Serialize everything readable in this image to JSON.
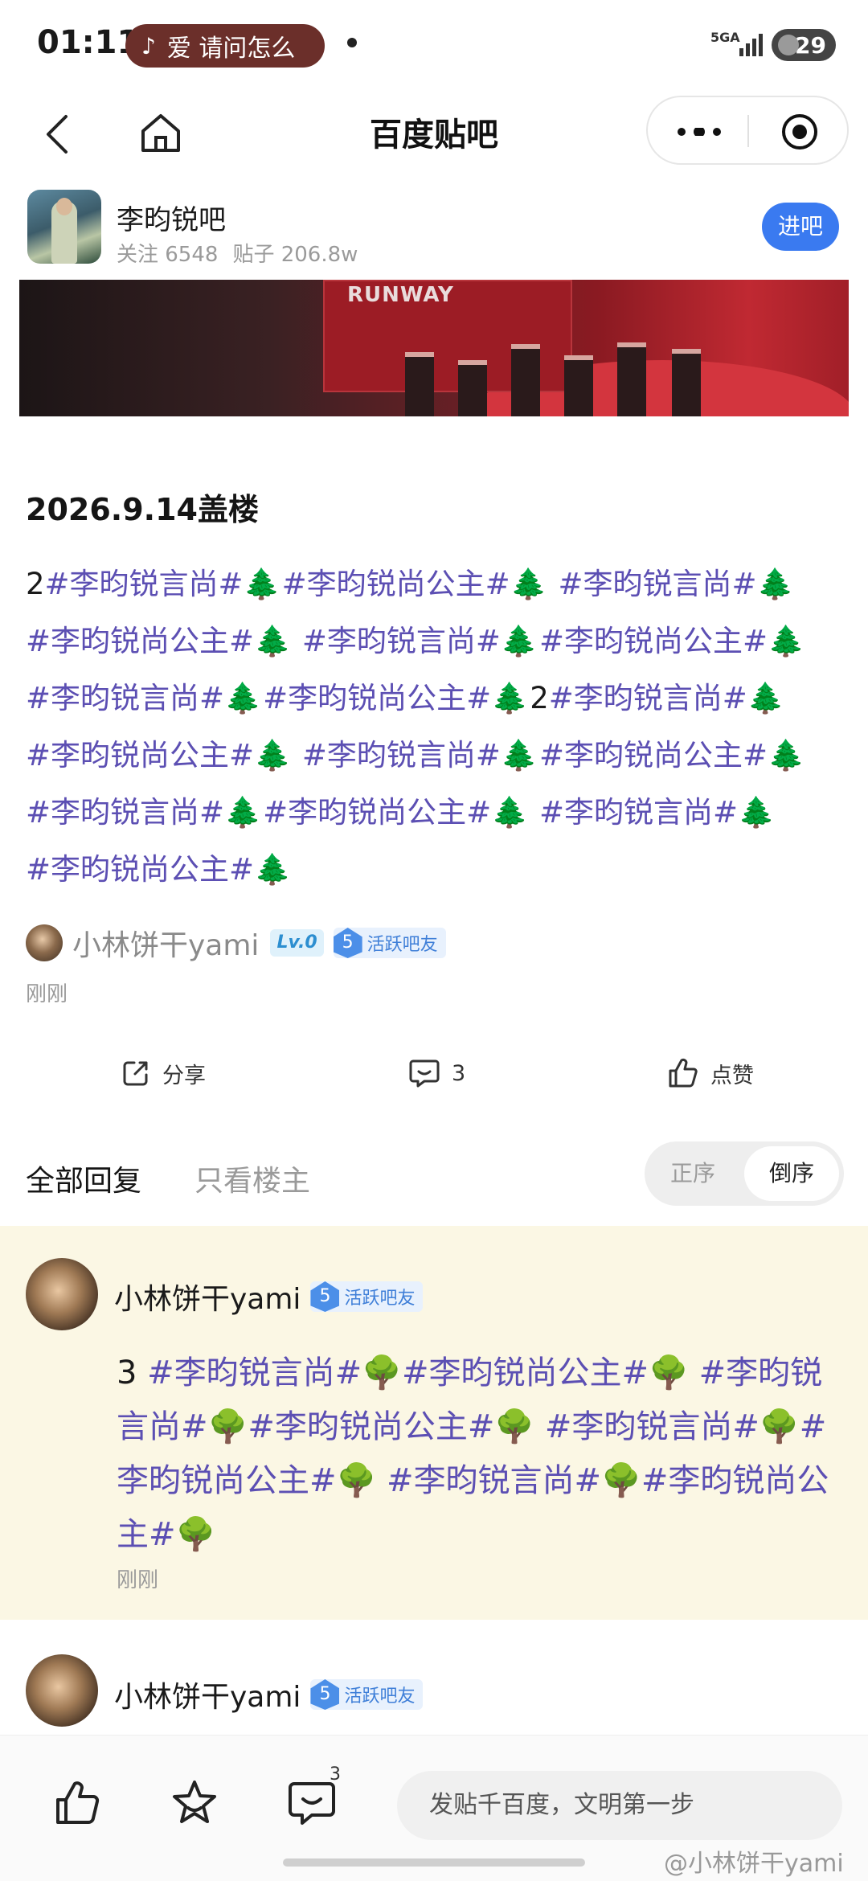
{
  "status_bar": {
    "time": "01:11",
    "music_text": "爱 请问怎么",
    "network": "5GA",
    "battery": "29"
  },
  "nav": {
    "title": "百度贴吧"
  },
  "forum": {
    "name": "李昀锐吧",
    "follows": "关注 6548",
    "posts": "贴子 206.8w",
    "join_label": "进吧"
  },
  "banner": {
    "text": "RUNWAY"
  },
  "post": {
    "title": "2026.9.14盖楼",
    "lines": [
      [
        [
          "n",
          "2"
        ],
        [
          "t",
          "#李昀锐言尚#"
        ],
        [
          "e",
          "🌲"
        ],
        [
          "t",
          "#李昀锐尚公主#"
        ],
        [
          "e",
          "🌲"
        ],
        [
          "n",
          " "
        ],
        [
          "t",
          "#李昀锐言尚#"
        ],
        [
          "e",
          "🌲"
        ]
      ],
      [
        [
          "t",
          "#李昀锐尚公主#"
        ],
        [
          "e",
          "🌲"
        ],
        [
          "n",
          " "
        ],
        [
          "t",
          "#李昀锐言尚#"
        ],
        [
          "e",
          "🌲"
        ],
        [
          "t",
          "#李昀锐尚公主#"
        ],
        [
          "e",
          "🌲"
        ]
      ],
      [
        [
          "t",
          "#李昀锐言尚#"
        ],
        [
          "e",
          "🌲"
        ],
        [
          "t",
          "#李昀锐尚公主#"
        ],
        [
          "e",
          "🌲"
        ],
        [
          "n",
          "2"
        ],
        [
          "t",
          "#李昀锐言尚#"
        ],
        [
          "e",
          "🌲"
        ]
      ],
      [
        [
          "t",
          "#李昀锐尚公主#"
        ],
        [
          "e",
          "🌲"
        ],
        [
          "n",
          " "
        ],
        [
          "t",
          "#李昀锐言尚#"
        ],
        [
          "e",
          "🌲"
        ],
        [
          "t",
          "#李昀锐尚公主#"
        ],
        [
          "e",
          "🌲"
        ]
      ],
      [
        [
          "t",
          "#李昀锐言尚#"
        ],
        [
          "e",
          "🌲"
        ],
        [
          "t",
          "#李昀锐尚公主#"
        ],
        [
          "e",
          "🌲"
        ],
        [
          "n",
          " "
        ],
        [
          "t",
          "#李昀锐言尚#"
        ],
        [
          "e",
          "🌲"
        ]
      ],
      [
        [
          "t",
          "#李昀锐尚公主#"
        ],
        [
          "e",
          "🌲"
        ]
      ]
    ],
    "author": "小林饼干yami",
    "level_badge": "Lv.0",
    "fan_level": "5",
    "fan_title": "活跃吧友",
    "time": "刚刚"
  },
  "actions": {
    "share": "分享",
    "comments": "3",
    "like": "点赞"
  },
  "reply_tabs": {
    "all": "全部回复",
    "host_only": "只看楼主",
    "sort_asc": "正序",
    "sort_desc": "倒序"
  },
  "replies": [
    {
      "author": "小林饼干yami",
      "fan_level": "5",
      "fan_title": "活跃吧友",
      "content": [
        [
          "n",
          "3 "
        ],
        [
          "t",
          "#李昀锐言尚#"
        ],
        [
          "e",
          "🌳"
        ],
        [
          "t",
          "#李昀锐尚公主#"
        ],
        [
          "e",
          "🌳"
        ],
        [
          "n",
          " "
        ],
        [
          "t",
          "#李昀锐言尚#"
        ],
        [
          "e",
          "🌳"
        ],
        [
          "t",
          "#李昀锐尚公主#"
        ],
        [
          "e",
          "🌳"
        ],
        [
          "n",
          " "
        ],
        [
          "t",
          "#李昀锐言尚#"
        ],
        [
          "e",
          "🌳"
        ],
        [
          "t",
          "#李昀锐尚公主#"
        ],
        [
          "e",
          "🌳"
        ],
        [
          "n",
          " "
        ],
        [
          "t",
          "#李昀锐言尚#"
        ],
        [
          "e",
          "🌳"
        ],
        [
          "t",
          "#李昀锐尚公主#"
        ],
        [
          "e",
          "🌳"
        ]
      ],
      "time": "刚刚"
    },
    {
      "author": "小林饼干yami",
      "fan_level": "5",
      "fan_title": "活跃吧友"
    }
  ],
  "bottom_bar": {
    "comment_count": "3",
    "input_placeholder": "发贴千百度，文明第一步"
  },
  "watermark": "@小林饼干yami",
  "colors": {
    "topic": "#5c4fb3",
    "accent": "#3a7af0",
    "reply_bg": "#fbf7e4"
  }
}
